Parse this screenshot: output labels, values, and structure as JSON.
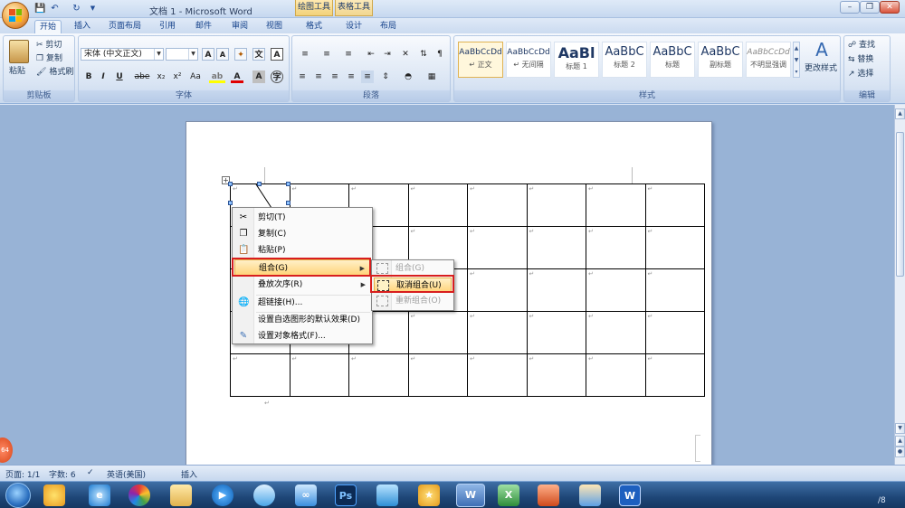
{
  "window": {
    "title": "文档 1 - Microsoft Word",
    "contextual_groups": [
      "绘图工具",
      "表格工具"
    ],
    "controls": [
      "minimize",
      "restore",
      "close"
    ]
  },
  "quick_access": [
    "save-icon",
    "undo-icon",
    "redo-icon"
  ],
  "tabs": [
    {
      "label": "开始",
      "active": true
    },
    {
      "label": "插入"
    },
    {
      "label": "页面布局"
    },
    {
      "label": "引用"
    },
    {
      "label": "邮件"
    },
    {
      "label": "审阅"
    },
    {
      "label": "视图"
    },
    {
      "label": "格式"
    },
    {
      "label": "设计"
    },
    {
      "label": "布局"
    }
  ],
  "ribbon": {
    "clipboard": {
      "label": "剪贴板",
      "paste": "粘贴",
      "cut": "剪切",
      "copy": "复制",
      "format_painter": "格式刷"
    },
    "font": {
      "label": "字体",
      "font_name": "宋体 (中文正文)",
      "font_size": "",
      "buttons": [
        "B",
        "I",
        "U",
        "abe",
        "x₂",
        "x²",
        "Aa"
      ]
    },
    "paragraph": {
      "label": "段落"
    },
    "styles": {
      "label": "样式",
      "items": [
        {
          "sample": "AaBbCcDd",
          "name": "↵ 正文"
        },
        {
          "sample": "AaBbCcDd",
          "name": "↵ 无间隔"
        },
        {
          "sample": "AaBl",
          "name": "标题 1"
        },
        {
          "sample": "AaBbC",
          "name": "标题 2"
        },
        {
          "sample": "AaBbC",
          "name": "标题"
        },
        {
          "sample": "AaBbC",
          "name": "副标题"
        },
        {
          "sample": "AaBbCcDd",
          "name": "不明显强调"
        }
      ],
      "change_styles": "更改样式"
    },
    "editing": {
      "label": "编辑",
      "find": "查找",
      "replace": "替换",
      "select": "选择"
    }
  },
  "document": {
    "table": {
      "rows": 5,
      "cols": 8,
      "cell_mark": "↵"
    },
    "paragraph_mark": "↵"
  },
  "context_menu": {
    "items": [
      {
        "label": "剪切(T)",
        "icon": "scissors-icon"
      },
      {
        "label": "复制(C)",
        "icon": "copy-icon"
      },
      {
        "label": "粘贴(P)",
        "icon": "paste-icon"
      },
      {
        "label": "组合(G)",
        "icon": "",
        "submenu": true,
        "highlighted": true
      },
      {
        "label": "叠放次序(R)",
        "icon": "",
        "submenu": true
      },
      {
        "label": "超链接(H)...",
        "icon": "globe-link-icon"
      },
      {
        "label": "设置自选图形的默认效果(D)",
        "icon": ""
      },
      {
        "label": "设置对象格式(F)...",
        "icon": "format-object-icon"
      }
    ]
  },
  "submenu": {
    "items": [
      {
        "label": "组合(G)",
        "enabled": false
      },
      {
        "label": "取消组合(U)",
        "enabled": true,
        "highlighted": true
      },
      {
        "label": "重新组合(O)",
        "enabled": false
      }
    ]
  },
  "statusbar": {
    "page": "页面: 1/1",
    "words": "字数: 6",
    "language": "英语(美国)",
    "mode": "插入"
  },
  "taskbar": {
    "badge": "64",
    "apps": [
      "ie-icon",
      "media-center-icon",
      "file-explorer-icon",
      "video-player-icon",
      "qq-icon",
      "baidu-cloud-icon",
      "photoshop-icon",
      "bird-icon",
      "star-icon",
      "word-icon",
      "excel-icon",
      "powerpoint-icon",
      "paint-icon",
      "wps-icon"
    ],
    "ps_label": "Ps",
    "wps_label": "W",
    "word_label": "W",
    "excel_label": "X",
    "clock_fragment": "/8"
  },
  "colors": {
    "ribbon_bg": "#dbe6f4",
    "highlight": "#ffd47a",
    "red_outline": "#d81e1e",
    "taskbar": "#1e4677"
  }
}
